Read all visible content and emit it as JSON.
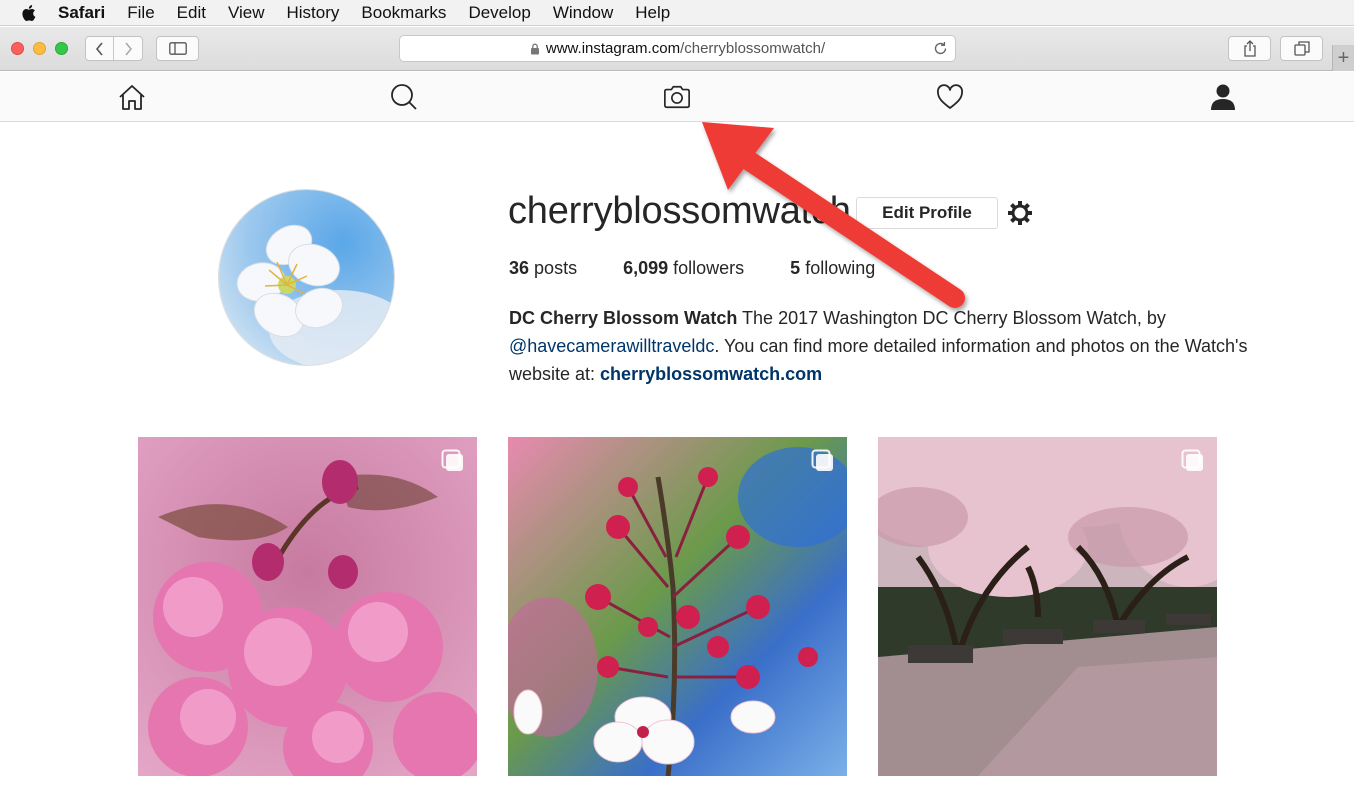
{
  "menubar": {
    "app": "Safari",
    "items": [
      "File",
      "Edit",
      "View",
      "History",
      "Bookmarks",
      "Develop",
      "Window",
      "Help"
    ]
  },
  "browser": {
    "url_host": "www.instagram.com",
    "url_path": "/cherryblossomwatch/"
  },
  "nav": {
    "icons": [
      "home-icon",
      "search-icon",
      "camera-icon",
      "heart-icon",
      "profile-icon"
    ]
  },
  "profile": {
    "username": "cherryblossomwatch",
    "edit_label": "Edit Profile",
    "posts_count": "36",
    "posts_label": "posts",
    "followers_count": "6,099",
    "followers_label": "followers",
    "following_count": "5",
    "following_label": "following",
    "bio_name": "DC Cherry Blossom Watch",
    "bio_text1": " The 2017 Washington DC Cherry Blossom Watch, by ",
    "bio_mention": "@havecamerawilltraveldc",
    "bio_text2": ". You can find more detailed information and photos on the Watch's website at: ",
    "bio_link": "cherryblossomwatch.com"
  },
  "colors": {
    "annotation_arrow": "#ef3b36",
    "link": "#003569"
  }
}
